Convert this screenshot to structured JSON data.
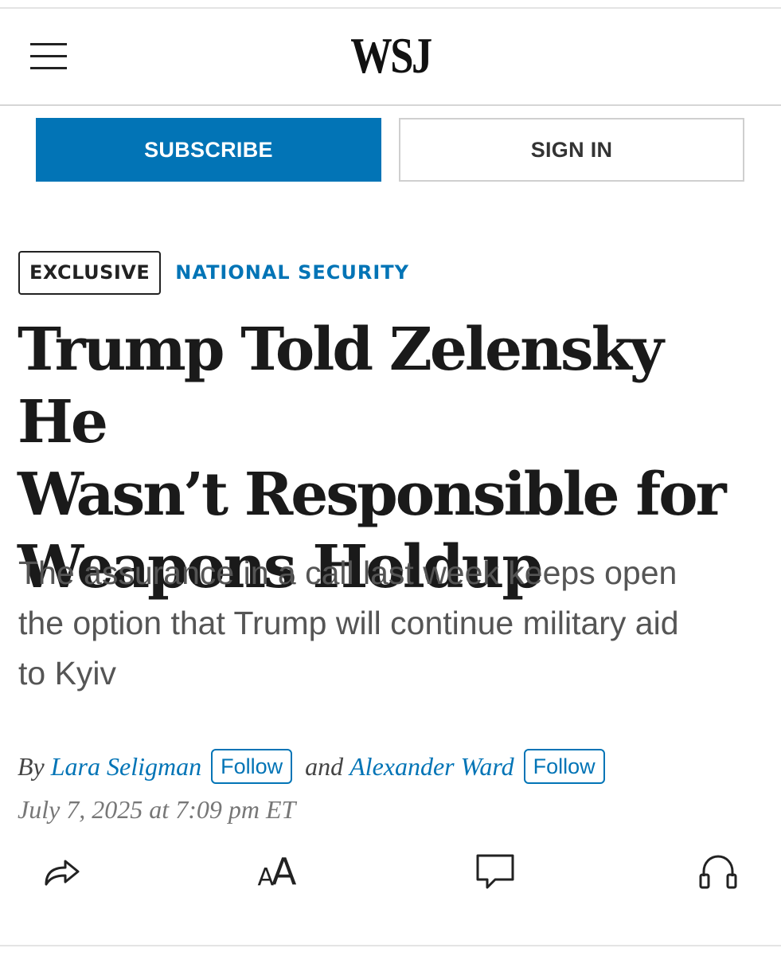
{
  "header": {
    "logo": "WSJ",
    "menu_icon": "hamburger-menu-icon"
  },
  "auth": {
    "subscribe_label": "SUBSCRIBE",
    "signin_label": "SIGN IN"
  },
  "article": {
    "flag": "EXCLUSIVE",
    "section": "NATIONAL SECURITY",
    "headline_lines": [
      "Trump Told Zelensky He",
      "Wasn’t Responsible for",
      "Weapons Holdup"
    ],
    "dek_lines": [
      "The assurance in a call last week keeps open",
      "the option that Trump will continue military aid",
      "to Kyiv"
    ],
    "byline": {
      "prefix": "By",
      "authors": [
        {
          "name": "Lara Seligman",
          "follow_label": "Follow"
        },
        {
          "name": "Alexander Ward",
          "follow_label": "Follow"
        }
      ],
      "conjunction": "and"
    },
    "date": "July 7, 2025 at 7:09 pm ET"
  },
  "toolbar": {
    "icons": [
      "share-icon",
      "text-size-icon",
      "comment-icon",
      "listen-icon"
    ],
    "text_size_glyphs": {
      "small": "A",
      "large": "A"
    }
  },
  "colors": {
    "accent": "#0274b6",
    "headline": "#1a1a1a",
    "dek": "#555555",
    "date": "#777777"
  }
}
